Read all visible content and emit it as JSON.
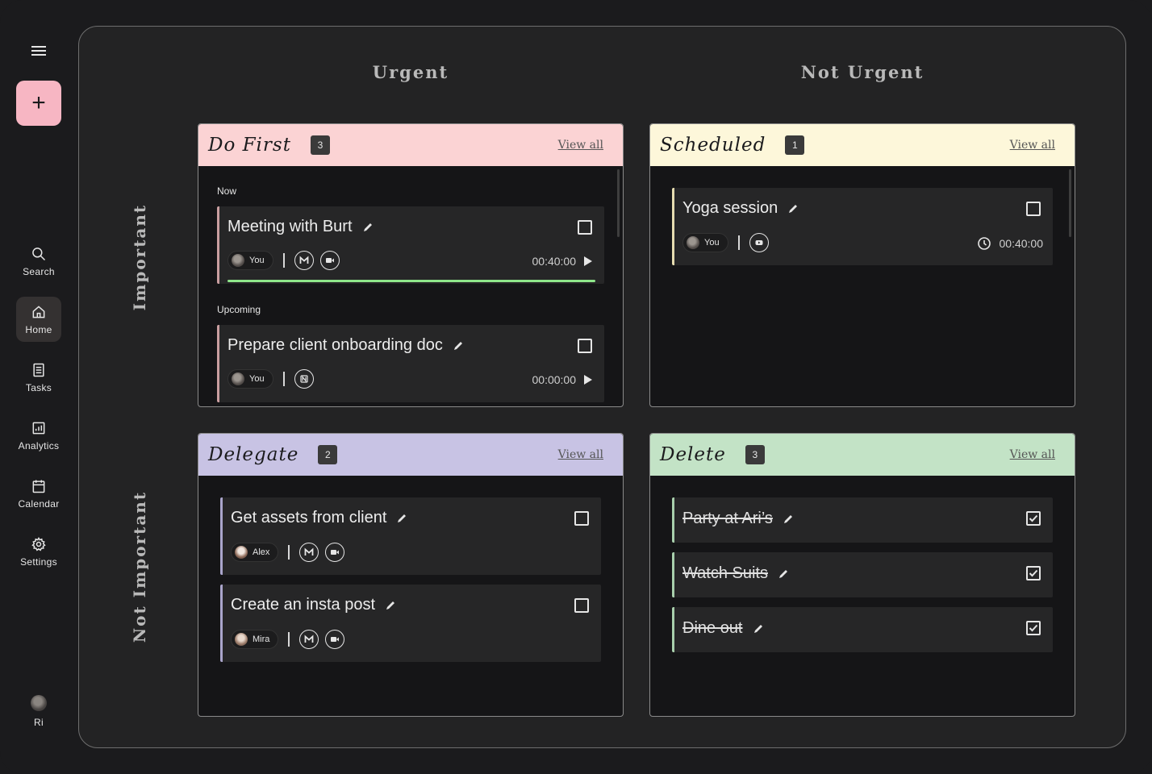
{
  "sidebar": {
    "items": [
      {
        "label": "Search",
        "icon": "search-icon"
      },
      {
        "label": "Home",
        "icon": "home-icon"
      },
      {
        "label": "Tasks",
        "icon": "tasks-icon"
      },
      {
        "label": "Analytics",
        "icon": "analytics-icon"
      },
      {
        "label": "Calendar",
        "icon": "calendar-icon"
      },
      {
        "label": "Settings",
        "icon": "gear-icon"
      }
    ],
    "add_label": "+",
    "user_name": "Ri"
  },
  "columns": {
    "urgent": "Urgent",
    "not_urgent": "Not Urgent"
  },
  "rows": {
    "important": "Important",
    "not_important": "Not Important"
  },
  "colors": {
    "do_first": "#fbd3d4",
    "scheduled": "#fdf7da",
    "delegate": "#c8c3e4",
    "delete": "#c3e3c6",
    "progress": "#8ee68a",
    "accent_add": "#f7b6c3"
  },
  "do_first": {
    "title": "Do First",
    "count": "3",
    "view_all": "View all",
    "now_label": "Now",
    "upcoming_label": "Upcoming",
    "tasks": [
      {
        "title": "Meeting with Burt",
        "assignee": "You",
        "apps": [
          "gmail-icon",
          "meet-icon"
        ],
        "time": "00:40:00",
        "progress": 1.0
      },
      {
        "title": "Prepare client onboarding doc",
        "assignee": "You",
        "apps": [
          "notion-icon"
        ],
        "time": "00:00:00"
      }
    ]
  },
  "scheduled": {
    "title": "Scheduled",
    "count": "1",
    "view_all": "View all",
    "tasks": [
      {
        "title": "Yoga session",
        "assignee": "You",
        "apps": [
          "youtube-icon"
        ],
        "time": "00:40:00"
      }
    ]
  },
  "delegate": {
    "title": "Delegate",
    "count": "2",
    "view_all": "View all",
    "tasks": [
      {
        "title": "Get assets from client",
        "assignee": "Alex",
        "apps": [
          "gmail-icon",
          "meet-icon"
        ]
      },
      {
        "title": "Create an insta post",
        "assignee": "Mira",
        "apps": [
          "gmail-icon",
          "meet-icon"
        ]
      }
    ]
  },
  "delete": {
    "title": "Delete",
    "count": "3",
    "view_all": "View all",
    "tasks": [
      {
        "title": "Party at Ari’s"
      },
      {
        "title": "Watch Suits"
      },
      {
        "title": "Dine out"
      }
    ]
  }
}
